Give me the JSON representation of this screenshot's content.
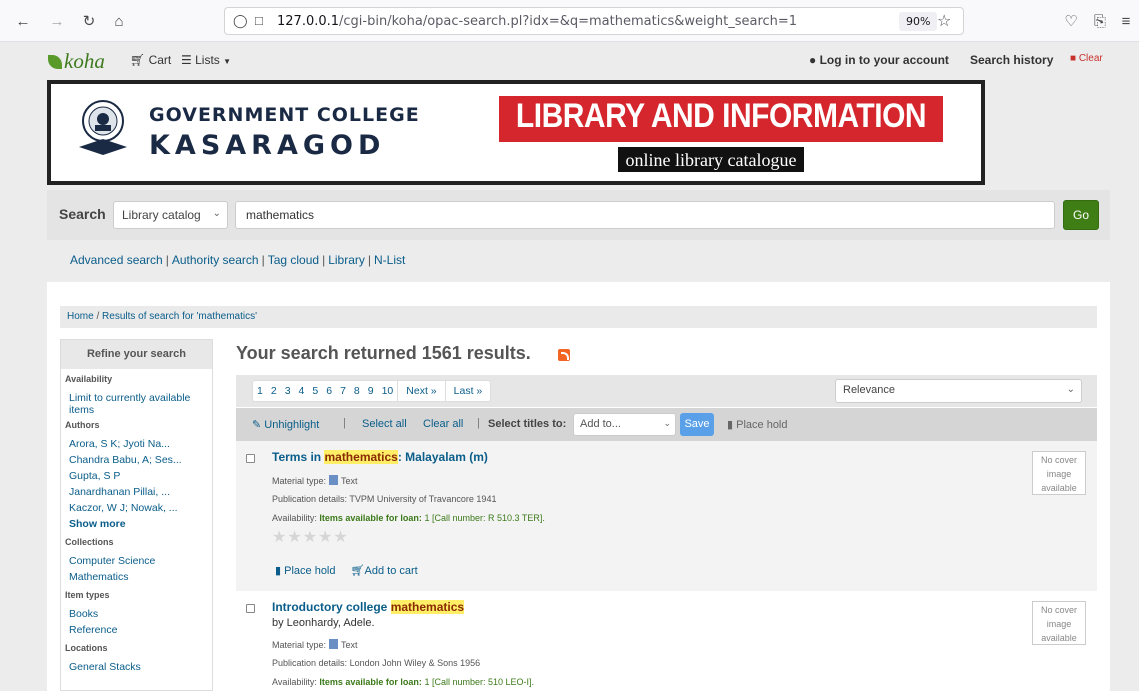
{
  "browser": {
    "url_host": "127.0.0.1",
    "url_path": "/cgi-bin/koha/opac-search.pl?idx=&q=mathematics&weight_search=1",
    "zoom": "90%"
  },
  "topnav": {
    "logo": "koha",
    "cart": "Cart",
    "lists": "Lists",
    "login": "Log in to your account",
    "history": "Search history",
    "clear": "Clear"
  },
  "banner": {
    "college_line1": "GOVERNMENT COLLEGE",
    "college_line2": "KASARAGOD",
    "lic": "LIBRARY AND INFORMATION CENTER",
    "olc": "online library catalogue"
  },
  "search": {
    "label": "Search",
    "scope": "Library catalog",
    "query": "mathematics",
    "go": "Go"
  },
  "links": [
    "Advanced search",
    "Authority search",
    "Tag cloud",
    "Library",
    "N-List"
  ],
  "breadcrumb": {
    "home": "Home",
    "current": "Results of search for 'mathematics'"
  },
  "facets": {
    "heading": "Refine your search",
    "availability_title": "Availability",
    "availability_item": "Limit to currently available items",
    "authors_title": "Authors",
    "authors": [
      "Arora, S K; Jyoti Na...",
      "Chandra Babu, A; Ses...",
      "Gupta, S P",
      "Janardhanan Pillai, ...",
      "Kaczor, W J; Nowak, ..."
    ],
    "show_more": "Show more",
    "collections_title": "Collections",
    "collections": [
      "Computer Science",
      "Mathematics"
    ],
    "itemtypes_title": "Item types",
    "itemtypes": [
      "Books",
      "Reference"
    ],
    "locations_title": "Locations",
    "locations": [
      "General Stacks"
    ]
  },
  "results": {
    "summary": "Your search returned 1561 results.",
    "pages": [
      "1",
      "2",
      "3",
      "4",
      "5",
      "6",
      "7",
      "8",
      "9",
      "10"
    ],
    "next": "Next »",
    "last": "Last »",
    "sort": "Relevance",
    "toolbar": {
      "unhighlight": "Unhighlight",
      "select_all": "Select all",
      "clear_all": "Clear all",
      "select_titles": "Select titles to:",
      "add_to": "Add to...",
      "save": "Save",
      "place_hold": "Place hold"
    },
    "items": [
      {
        "title_pre": "Terms in ",
        "title_hl": "mathematics",
        "title_post": ": Malayalam (m)",
        "author": "",
        "material_label": "Material type:",
        "material": "Text",
        "pub_label": "Publication details:",
        "pub": "TVPM University of Travancore 1941",
        "avail_label": "Availability:",
        "avail_strong": "Items available for loan:",
        "avail_rest": "1 [Call number: R 510.3 TER].",
        "stars": "★★★★★",
        "place_hold": "Place hold",
        "add_cart": "Add to cart",
        "cover": "No cover image available"
      },
      {
        "title_pre": "Introductory college ",
        "title_hl": "mathematics",
        "title_post": "",
        "author": "by Leonhardy, Adele.",
        "material_label": "Material type:",
        "material": "Text",
        "pub_label": "Publication details:",
        "pub": "London John Wiley & Sons 1956",
        "avail_label": "Availability:",
        "avail_strong": "Items available for loan:",
        "avail_rest": "1 [Call number: 510 LEO-I].",
        "cover": "No cover image available"
      }
    ]
  }
}
